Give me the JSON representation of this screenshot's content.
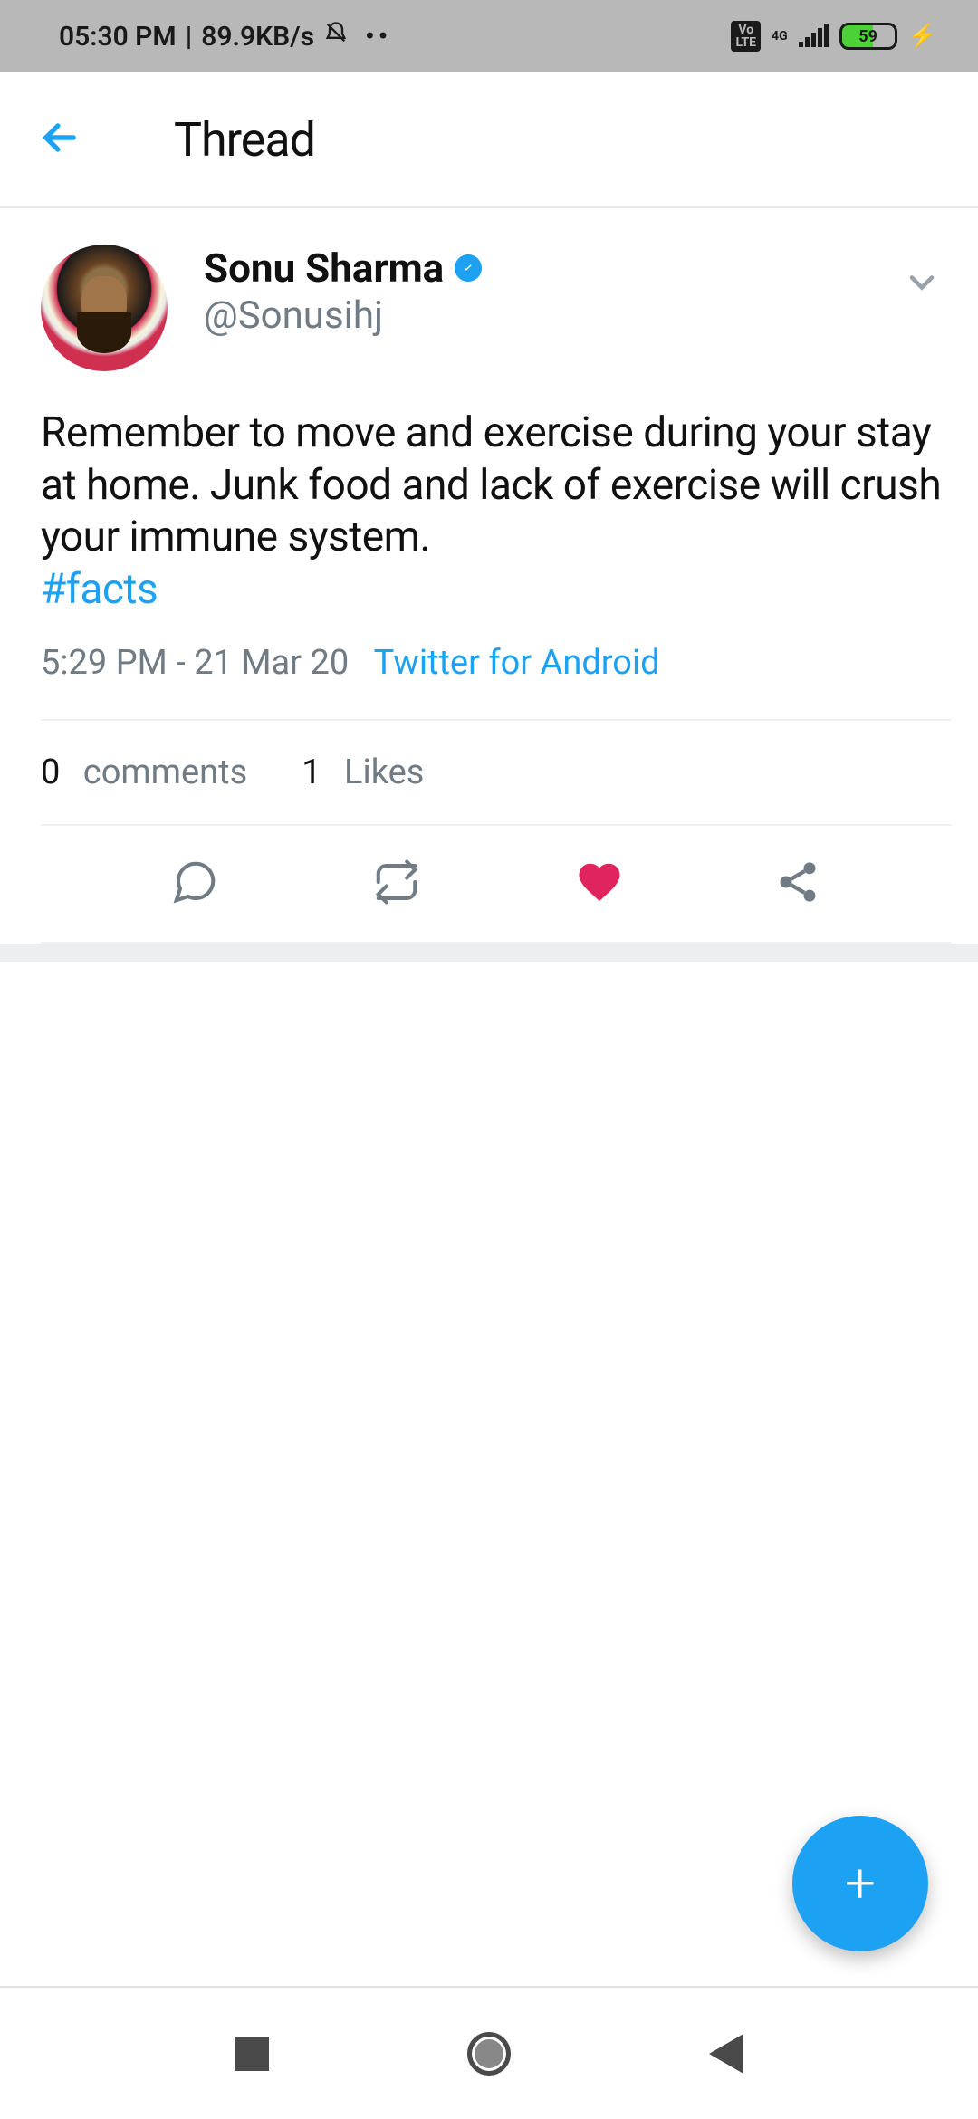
{
  "status": {
    "time": "05:30 PM",
    "speed": "89.9KB/s",
    "network": "4G",
    "volte": "Vo\nLTE",
    "battery": "59"
  },
  "header": {
    "title": "Thread"
  },
  "tweet": {
    "author": {
      "name": "Sonu Sharma",
      "handle": "@Sonusihj"
    },
    "text": "Remember to move and exercise  during your stay at home. Junk food and lack of exercise will crush your immune system.",
    "hashtag": "#facts",
    "timestamp": "5:29 PM - 21 Mar 20",
    "source": "Twitter for Android",
    "stats": {
      "comments_count": "0",
      "comments_label": "comments",
      "likes_count": "1",
      "likes_label": "Likes"
    }
  },
  "fab": {
    "label": "+"
  }
}
